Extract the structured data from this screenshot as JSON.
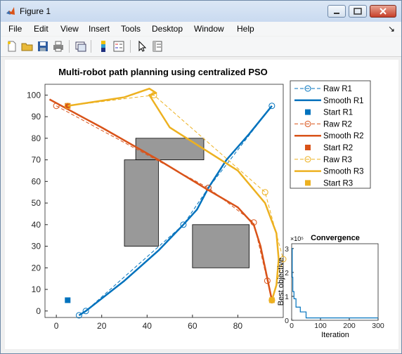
{
  "window": {
    "title": "Figure 1",
    "colors": {
      "r1": "#0072bd",
      "r2": "#d95319",
      "r3": "#edb120",
      "obstacle": "#999999"
    }
  },
  "menu": [
    "File",
    "Edit",
    "View",
    "Insert",
    "Tools",
    "Desktop",
    "Window",
    "Help"
  ],
  "menu_arrow": "↘",
  "toolbar": [
    "new-figure-icon",
    "open-file-icon",
    "save-icon",
    "print-icon",
    "link-plot-icon",
    "colorbar-icon",
    "legend-icon",
    "pointer-icon",
    "property-inspector-icon"
  ],
  "chart_data": [
    {
      "type": "line",
      "title": "Multi-robot path planning using centralized PSO",
      "xlim": [
        -5,
        100
      ],
      "ylim": [
        -3,
        105
      ],
      "xticks": [
        0,
        20,
        40,
        60,
        80
      ],
      "yticks": [
        0,
        10,
        20,
        30,
        40,
        50,
        60,
        70,
        80,
        90,
        100
      ],
      "grid": false,
      "legend_position": "outside-right-top",
      "obstacles": [
        {
          "x": [
            35,
            65
          ],
          "y": [
            70,
            80
          ]
        },
        {
          "x": [
            30,
            45
          ],
          "y": [
            30,
            70
          ]
        },
        {
          "x": [
            60,
            85
          ],
          "y": [
            20,
            40
          ]
        }
      ],
      "series": [
        {
          "name": "Raw R1",
          "style": "dashed-circle",
          "color": "#0072bd",
          "x": [
            10,
            13,
            56,
            67,
            95
          ],
          "y": [
            -2,
            0,
            40,
            57,
            95
          ]
        },
        {
          "name": "Smooth R1",
          "style": "solid",
          "color": "#0072bd",
          "x": [
            10,
            13,
            30,
            45,
            56,
            62,
            67,
            75,
            85,
            95
          ],
          "y": [
            -2,
            0,
            14,
            28,
            40,
            47,
            57,
            70,
            82,
            95
          ]
        },
        {
          "name": "Start R1",
          "style": "square",
          "color": "#0072bd",
          "x": [
            5
          ],
          "y": [
            5
          ]
        },
        {
          "name": "Raw R2",
          "style": "dashed-circle",
          "color": "#d95319",
          "x": [
            0,
            67,
            87,
            93,
            95
          ],
          "y": [
            95,
            57,
            41,
            14,
            5
          ]
        },
        {
          "name": "Smooth R2",
          "style": "solid",
          "color": "#d95319",
          "x": [
            -3,
            20,
            45,
            67,
            80,
            87,
            90,
            92,
            94,
            95
          ],
          "y": [
            98,
            85,
            70,
            56,
            48,
            40,
            30,
            20,
            10,
            5
          ]
        },
        {
          "name": "Start R2",
          "style": "square",
          "color": "#d95319",
          "x": [
            5
          ],
          "y": [
            95
          ]
        },
        {
          "name": "Raw R3",
          "style": "dashed-circle",
          "color": "#edb120",
          "x": [
            5,
            43,
            92,
            100,
            95
          ],
          "y": [
            95,
            100,
            55,
            24,
            5
          ]
        },
        {
          "name": "Smooth R3",
          "style": "solid",
          "color": "#edb120",
          "x": [
            5,
            30,
            41,
            44,
            41,
            50,
            80,
            92,
            97,
            98,
            97,
            95
          ],
          "y": [
            95,
            99,
            103,
            101,
            100,
            85,
            65,
            50,
            36,
            24,
            12,
            5
          ]
        },
        {
          "name": "Start R3",
          "style": "square",
          "color": "#edb120",
          "x": [
            95
          ],
          "y": [
            5
          ]
        }
      ]
    },
    {
      "type": "line",
      "title": "Convergence",
      "xlabel": "Iteration",
      "ylabel": "Best objective",
      "exponent_label": "×10⁵",
      "xlim": [
        0,
        300
      ],
      "ylim": [
        0,
        3.2
      ],
      "xticks": [
        0,
        100,
        200,
        300
      ],
      "yticks": [
        0,
        1,
        2,
        3
      ],
      "series": [
        {
          "color": "#0072bd",
          "x": [
            0,
            2,
            2,
            4,
            4,
            8,
            8,
            15,
            15,
            30,
            30,
            50,
            50,
            300
          ],
          "y": [
            3.0,
            3.0,
            1.8,
            1.8,
            1.2,
            1.2,
            0.9,
            0.9,
            0.55,
            0.55,
            0.35,
            0.35,
            0.1,
            0.1
          ]
        }
      ]
    }
  ]
}
